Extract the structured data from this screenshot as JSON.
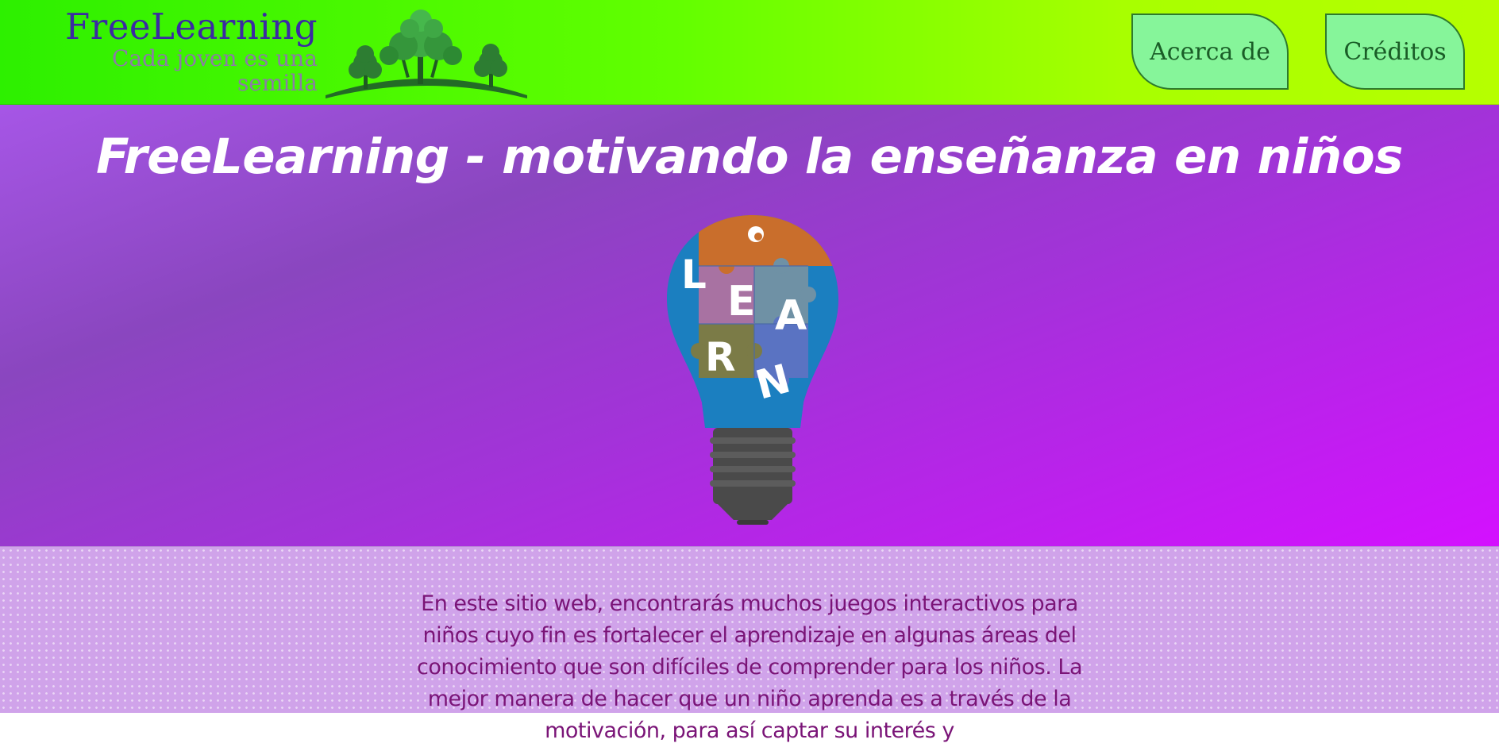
{
  "header": {
    "brand_title": "FreeLearning",
    "brand_tagline": "Cada joven es una semilla",
    "logo_icon": "trees-icon",
    "nav": {
      "about_label": "Acerca de",
      "credits_label": "Créditos"
    }
  },
  "hero": {
    "title": "FreeLearning - motivando la enseñanza en niños",
    "illustration_icon": "learn-lightbulb-puzzle-icon",
    "bulb_letters": [
      "L",
      "E",
      "A",
      "R",
      "N"
    ]
  },
  "content": {
    "paragraph": "En este sitio web, encontrarás muchos juegos interactivos para niños cuyo fin es fortalecer el aprendizaje en algunas áreas del conocimiento que son difíciles de comprender para los niños. La mejor manera de hacer que un niño aprenda es a través de la motivación, para así captar su interés y"
  },
  "colors": {
    "header_green": "#62ff00",
    "brand_title": "#3b2aa3",
    "nav_button_bg": "#86f59a",
    "nav_button_border": "#2f7a2c",
    "hero_purple": "#a233d8",
    "hero_magenta": "#d410ff",
    "content_bg": "#d0a3ea",
    "content_text": "#7a1477"
  }
}
